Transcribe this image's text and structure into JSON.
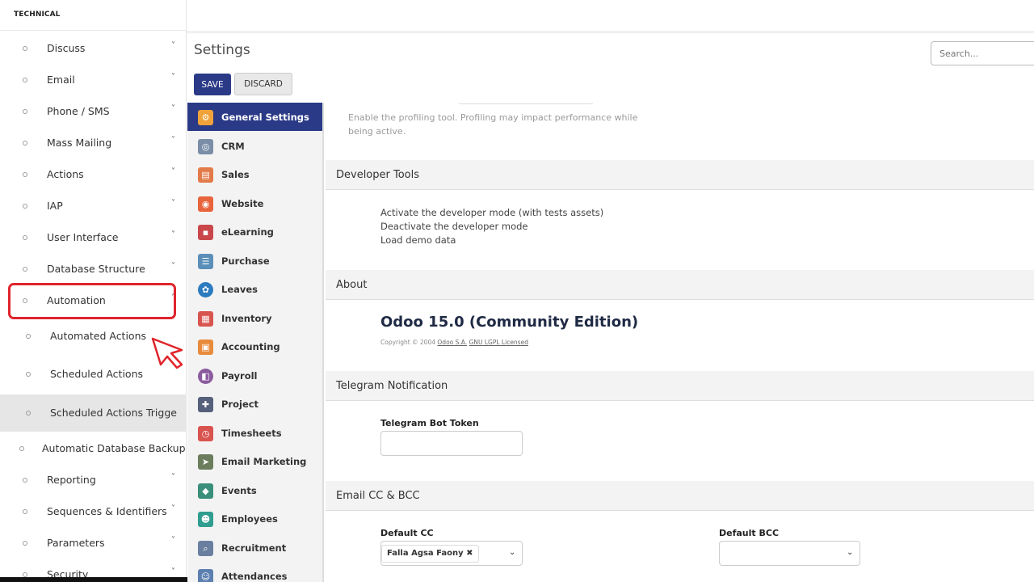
{
  "menu": {
    "header": "TECHNICAL",
    "items": [
      {
        "label": "Discuss",
        "chevron": "˅"
      },
      {
        "label": "Email",
        "chevron": "˅"
      },
      {
        "label": "Phone / SMS",
        "chevron": "˅"
      },
      {
        "label": "Mass Mailing",
        "chevron": "˅"
      },
      {
        "label": "Actions",
        "chevron": "˅"
      },
      {
        "label": "IAP",
        "chevron": "˅"
      },
      {
        "label": "User Interface",
        "chevron": "˅"
      },
      {
        "label": "Database Structure",
        "chevron": "˅"
      },
      {
        "label": "Automation",
        "chevron": "˄"
      },
      {
        "label": "Automated Actions"
      },
      {
        "label": "Scheduled Actions"
      },
      {
        "label": "Scheduled Actions Trigge"
      },
      {
        "label": "Automatic Database Backup"
      },
      {
        "label": "Reporting",
        "chevron": "˅"
      },
      {
        "label": "Sequences & Identifiers",
        "chevron": "˅"
      },
      {
        "label": "Parameters",
        "chevron": "˅"
      },
      {
        "label": "Security",
        "chevron": "˅"
      }
    ]
  },
  "control": {
    "title": "Settings",
    "search_placeholder": "Search...",
    "save_label": "SAVE",
    "discard_label": "DISCARD"
  },
  "apps": [
    {
      "label": "General Settings",
      "color": "#f0a33a"
    },
    {
      "label": "CRM",
      "color": "#7b8ea8"
    },
    {
      "label": "Sales",
      "color": "#e27a4a"
    },
    {
      "label": "Website",
      "color": "#e8643c"
    },
    {
      "label": "eLearning",
      "color": "#c9474b"
    },
    {
      "label": "Purchase",
      "color": "#5b8fb9"
    },
    {
      "label": "Leaves",
      "color": "#2c7bbf"
    },
    {
      "label": "Inventory",
      "color": "#d8554f"
    },
    {
      "label": "Accounting",
      "color": "#e88b3c"
    },
    {
      "label": "Payroll",
      "color": "#8a5b9e"
    },
    {
      "label": "Project",
      "color": "#55607a"
    },
    {
      "label": "Timesheets",
      "color": "#d9534f"
    },
    {
      "label": "Email Marketing",
      "color": "#6b7d5c"
    },
    {
      "label": "Events",
      "color": "#3a8f7a"
    },
    {
      "label": "Employees",
      "color": "#2f9d8f"
    },
    {
      "label": "Recruitment",
      "color": "#6a7fa0"
    },
    {
      "label": "Attendances",
      "color": "#5c7fb0"
    }
  ],
  "content": {
    "profiling_text_1": "Enable the profiling tool. Profiling may impact performance while",
    "profiling_text_2": "being active.",
    "dev_tools": {
      "heading": "Developer Tools",
      "link1": "Activate the developer mode (with tests assets)",
      "link2": "Deactivate the developer mode",
      "link3": "Load demo data"
    },
    "about": {
      "heading": "About",
      "version": "Odoo 15.0 (Community Edition)",
      "copyright_prefix": "Copyright © 2004",
      "company": "Odoo S.A.",
      "license": "GNU LGPL Licensed"
    },
    "telegram": {
      "heading": "Telegram Notification",
      "token_label": "Telegram Bot Token"
    },
    "email_cc": {
      "heading": "Email CC & BCC",
      "cc_label": "Default CC",
      "cc_tag": "Falla Agsa Faony",
      "bcc_label": "Default BCC"
    }
  },
  "colors": {
    "primary": "#2b3a87",
    "highlight": "#e0242b"
  }
}
